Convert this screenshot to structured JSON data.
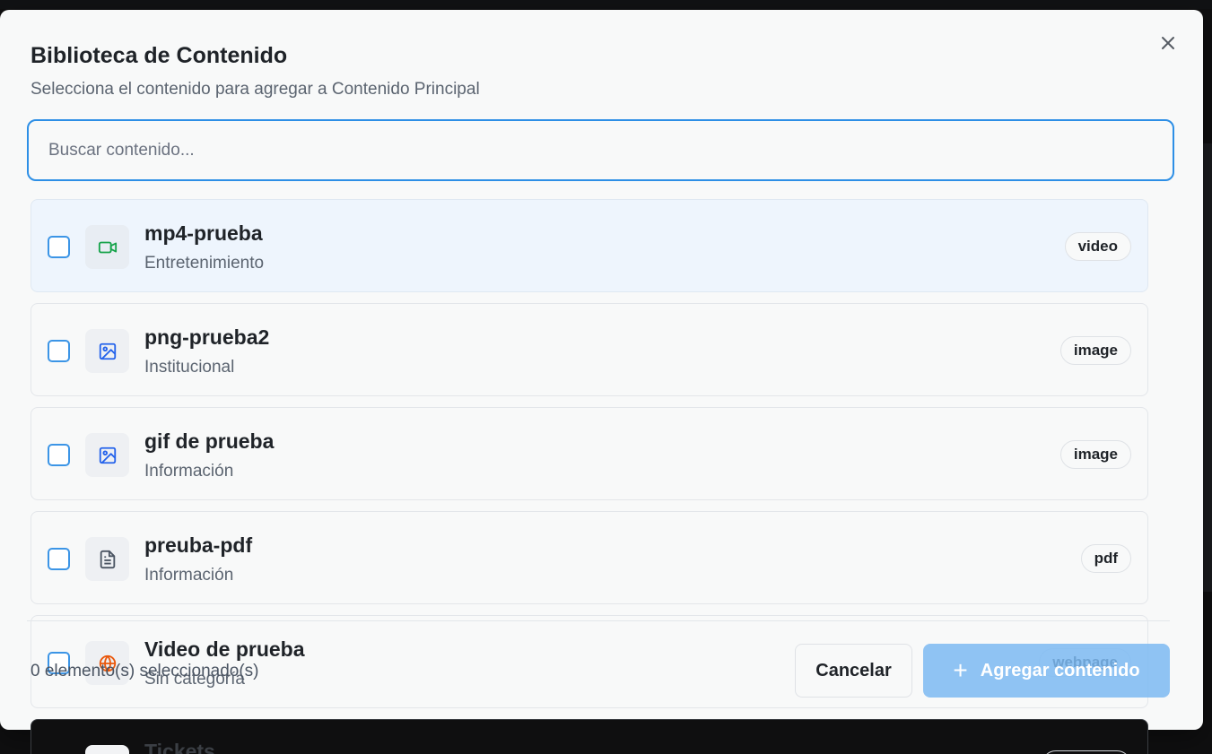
{
  "modal": {
    "title": "Biblioteca de Contenido",
    "subtitle": "Selecciona el contenido para agregar a Contenido Principal",
    "close_icon": "close-icon"
  },
  "search": {
    "placeholder": "Buscar contenido...",
    "value": ""
  },
  "items": [
    {
      "name": "mp4-prueba",
      "category": "Entretenimiento",
      "type": "video",
      "icon": "video-icon",
      "icon_color": "#16a34a",
      "highlighted": true
    },
    {
      "name": "png-prueba2",
      "category": "Institucional",
      "type": "image",
      "icon": "image-icon",
      "icon_color": "#2563eb"
    },
    {
      "name": "gif de prueba",
      "category": "Información",
      "type": "image",
      "icon": "image-icon",
      "icon_color": "#2563eb"
    },
    {
      "name": "preuba-pdf",
      "category": "Información",
      "type": "pdf",
      "icon": "file-text-icon",
      "icon_color": "#4b5563"
    },
    {
      "name": "Video de prueba",
      "category": "Sin categoría",
      "type": "webpage",
      "icon": "globe-icon",
      "icon_color": "#ea580c"
    },
    {
      "name": "Tickets"
    }
  ],
  "footer": {
    "selected_count": "0 elemento(s) seleccionado(s)",
    "cancel_label": "Cancelar",
    "add_label": "Agregar contenido"
  },
  "colors": {
    "accent": "#2d8fe6",
    "add_button": "#7dbaf2"
  }
}
